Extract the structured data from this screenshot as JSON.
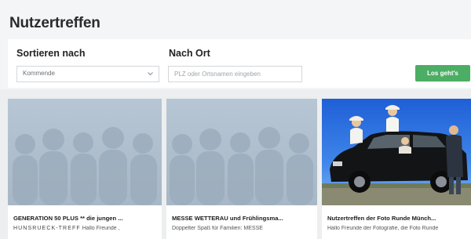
{
  "header": {
    "title": "Nutzertreffen"
  },
  "filters": {
    "sort_label": "Sortieren nach",
    "sort_value": "Kommende",
    "location_label": "Nach Ort",
    "location_placeholder": "PLZ oder Ortsnamen eingeben",
    "submit_label": "Los geht's"
  },
  "cards": [
    {
      "title": "GENERATION 50 PLUS ** die jungen ...",
      "desc_caps": "HUNSRUECK-TREFF",
      "desc_rest": "Hallo Freunde ,",
      "image": "placeholder-group-silhouettes"
    },
    {
      "title": "MESSE WETTERAU und Frühlingsma...",
      "desc_caps": "",
      "desc_rest": "Doppelter Spaß für Familien: MESSE",
      "image": "placeholder-group-silhouettes"
    },
    {
      "title": "Nutzertreffen der Foto Runde Münch...",
      "desc_caps": "",
      "desc_rest": "Hallo Freunde der Fotografie, die Foto Runde",
      "image": "photo-people-with-black-car"
    }
  ],
  "colors": {
    "accent_green": "#4cae64",
    "page_bg": "#eceeef",
    "placeholder_image_bg": "#aebecd"
  }
}
